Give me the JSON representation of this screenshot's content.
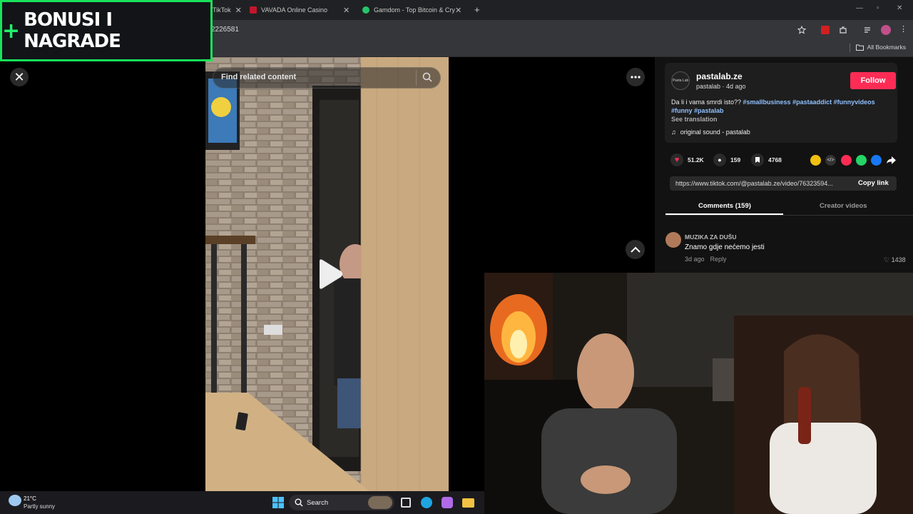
{
  "browser": {
    "tabs": [
      {
        "label": "TikTok",
        "favicon_color": "#000000"
      },
      {
        "label": "VAVADA Online Casino",
        "favicon_color": "#c0172c"
      },
      {
        "label": "Gamdom - Top Bitcoin & Crypto",
        "favicon_color": "#27c46a"
      }
    ],
    "new_tab": "+",
    "url_fragment": "2226581",
    "bookmarks_label": "All Bookmarks"
  },
  "overlay": {
    "plus": "+",
    "banner_text": "BONUSI I NAGRADE",
    "accent_color": "#18e35a"
  },
  "video": {
    "search_placeholder": "Find related content",
    "close_icon": "close-icon",
    "more_icon": "more-icon",
    "play_icon": "play-icon"
  },
  "post": {
    "author_name": "pastalab.ze",
    "author_handle": "pastalab",
    "author_dot": " · ",
    "posted": "4d ago",
    "avatar_text": "Pasta Lab",
    "follow_label": "Follow",
    "caption_text": "Da li i vama smrdi isto?? ",
    "hashtags": [
      "#smallbusiness",
      "#pastaaddict",
      "#funnyvideos",
      "#funny",
      "#pastalab"
    ],
    "see_translation": "See translation",
    "sound": "original sound - pastalab",
    "likes": "51.2K",
    "comments": "159",
    "saves": "4768",
    "link": "https://www.tiktok.com/@pastalab.ze/video/76323594...",
    "copy_link": "Copy link"
  },
  "panel_tabs": {
    "comments": "Comments (159)",
    "creator": "Creator videos"
  },
  "comment": {
    "user": "MUZIKA ZA DUŠU",
    "text": "Znamo gdje nećemo jesti",
    "time": "3d ago",
    "reply": "Reply",
    "likes": "1438"
  },
  "taskbar": {
    "temperature": "21°C",
    "weather": "Partly sunny",
    "search_label": "Search"
  }
}
